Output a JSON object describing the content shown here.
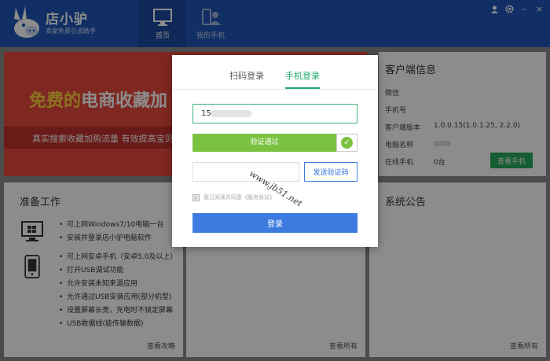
{
  "app": {
    "name": "店小驴",
    "slogan": "卖家免费引流助手"
  },
  "nav": {
    "tabs": [
      {
        "label": "首页",
        "active": true
      },
      {
        "label": "我的手机",
        "active": false
      }
    ]
  },
  "window_controls": {
    "user": "user-icon",
    "settings": "gear-icon",
    "minimize": "–",
    "close": "×"
  },
  "banner": {
    "headline_accent": "免费的",
    "headline_main": "电商收藏加",
    "subtitle": "真实搜索收藏加购流量    有效提高宝贝"
  },
  "client_info": {
    "title": "客户端信息",
    "rows": [
      {
        "label": "微信",
        "value": ""
      },
      {
        "label": "手机号",
        "value": ""
      },
      {
        "label": "客户端版本",
        "value": "1.0.0.15(1.0.1.25, 2.2.0)"
      },
      {
        "label": "电脑名称",
        "value": ""
      },
      {
        "label": "在线手机",
        "value": "0台"
      }
    ],
    "view_phone_button": "查看手机"
  },
  "prep": {
    "title": "准备工作",
    "pc_items": [
      "可上网Windows7/10电脑一台",
      "安装并登录店小驴电脑软件"
    ],
    "phone_items": [
      "可上网安卓手机（安卓5.0及以上）",
      "打开USB调试功能",
      "允许安装未知来源应用",
      "允许通过USB安装应用(部分机型)",
      "设置屏幕长亮，充电时不锁定屏幕",
      "USB数据线(能传输数据)"
    ],
    "link": "查看攻略"
  },
  "mid": {
    "link": "查看所有"
  },
  "notice": {
    "title": "系统公告",
    "link": "查看所有"
  },
  "login_modal": {
    "tabs": [
      {
        "label": "扫码登录",
        "active": false
      },
      {
        "label": "手机登录",
        "active": true
      }
    ],
    "phone_value": "15",
    "verify_text": "验证通过",
    "code_placeholder": "",
    "send_code_button": "发送验证码",
    "agree_text": "我已阅读并同意《服务协议》",
    "login_button": "登录"
  },
  "watermark": "www.jb51.net",
  "colors": {
    "topbar": "#1f56b7",
    "accent_green": "#1fa86a",
    "verify_green": "#7cc241",
    "primary_blue": "#3e7be0",
    "banner_red": "#e84a3c"
  }
}
